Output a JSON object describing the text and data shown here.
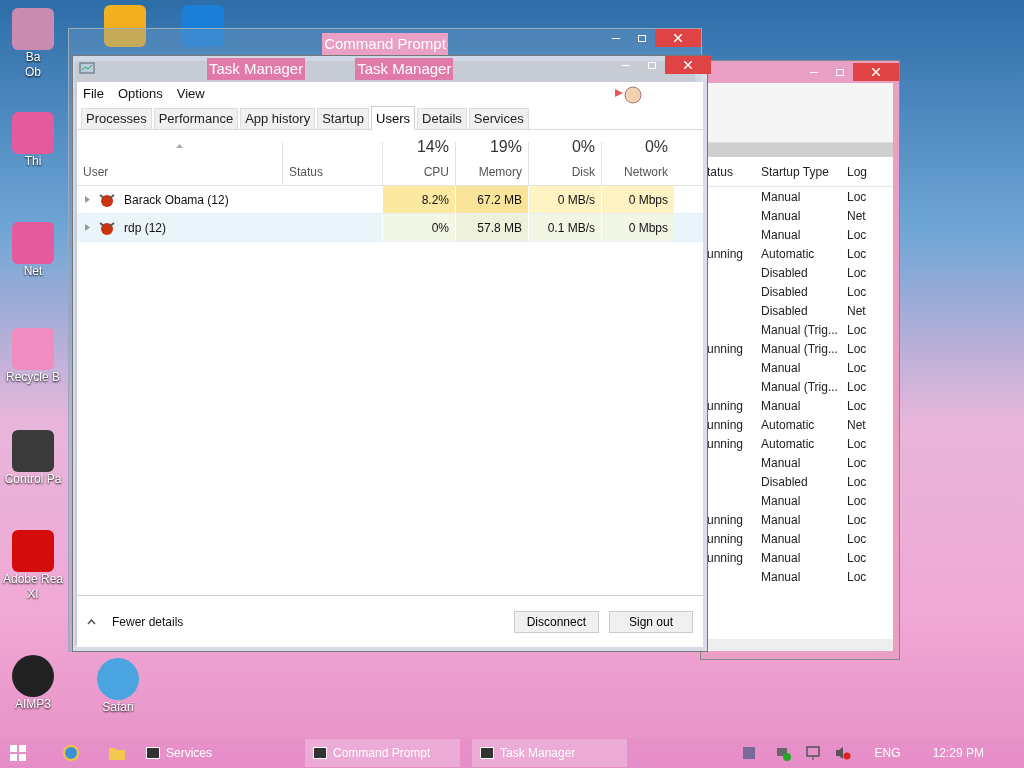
{
  "desktop_icons": [
    {
      "kind": "person",
      "lines": [
        "Ba",
        "Ob"
      ]
    },
    {
      "kind": "pink",
      "lines": [
        "Thi"
      ]
    },
    {
      "kind": "pink",
      "lines": [
        "Net"
      ]
    },
    {
      "kind": "recycle",
      "lines": [
        "Recycle B"
      ]
    },
    {
      "kind": "control",
      "lines": [
        "Control Pa"
      ]
    },
    {
      "kind": "pdf",
      "lines": [
        "Adobe Rea",
        "XI"
      ]
    },
    {
      "kind": "aimp",
      "lines": [
        "AIMP3"
      ]
    },
    {
      "kind": "safari",
      "lines": [
        "Safari"
      ]
    },
    {
      "kind": "video"
    },
    {
      "kind": "remote"
    }
  ],
  "command_prompt": {
    "title": "Command Prompt"
  },
  "services_window": {
    "columns": [
      "tatus",
      "Startup Type",
      "Log"
    ],
    "rows": [
      [
        "",
        "Manual",
        "Loc"
      ],
      [
        "",
        "Manual",
        "Net"
      ],
      [
        "",
        "Manual",
        "Loc"
      ],
      [
        "unning",
        "Automatic",
        "Loc"
      ],
      [
        "",
        "Disabled",
        "Loc"
      ],
      [
        "",
        "Disabled",
        "Loc"
      ],
      [
        "",
        "Disabled",
        "Net"
      ],
      [
        "",
        "Manual (Trig...",
        "Loc"
      ],
      [
        "unning",
        "Manual (Trig...",
        "Loc"
      ],
      [
        "",
        "Manual",
        "Loc"
      ],
      [
        "",
        "Manual (Trig...",
        "Loc"
      ],
      [
        "unning",
        "Manual",
        "Loc"
      ],
      [
        "unning",
        "Automatic",
        "Net"
      ],
      [
        "unning",
        "Automatic",
        "Loc"
      ],
      [
        "",
        "Manual",
        "Loc"
      ],
      [
        "",
        "Disabled",
        "Loc"
      ],
      [
        "",
        "Manual",
        "Loc"
      ],
      [
        "unning",
        "Manual",
        "Loc"
      ],
      [
        "unning",
        "Manual",
        "Loc"
      ],
      [
        "unning",
        "Manual",
        "Loc"
      ],
      [
        "",
        "Manual",
        "Loc"
      ]
    ]
  },
  "task_manager": {
    "titles": [
      "Task Manager",
      "Task Manager"
    ],
    "menu": [
      "File",
      "Options",
      "View"
    ],
    "tabs": [
      {
        "label": "Processes",
        "selected": false
      },
      {
        "label": "Performance",
        "selected": false
      },
      {
        "label": "App history",
        "selected": false
      },
      {
        "label": "Startup",
        "selected": false
      },
      {
        "label": "Users",
        "selected": true
      },
      {
        "label": "Details",
        "selected": false
      },
      {
        "label": "Services",
        "selected": false
      }
    ],
    "columns": [
      {
        "label": "User"
      },
      {
        "label": "Status"
      },
      {
        "total": "14%",
        "label": "CPU"
      },
      {
        "total": "19%",
        "label": "Memory"
      },
      {
        "total": "0%",
        "label": "Disk"
      },
      {
        "total": "0%",
        "label": "Network"
      }
    ],
    "rows": [
      {
        "highlighted": false,
        "cells": [
          {
            "text": "Barack Obama (12)"
          },
          {
            "text": ""
          },
          {
            "text": "8.2%",
            "color": "#fbe9a2"
          },
          {
            "text": "67.2 MB",
            "color": "#f9e49a"
          },
          {
            "text": "0 MB/s",
            "color": "#fff3c4"
          },
          {
            "text": "0 Mbps",
            "color": "#fff3c4"
          }
        ]
      },
      {
        "highlighted": true,
        "cells": [
          {
            "text": "rdp (12)"
          },
          {
            "text": ""
          },
          {
            "text": "0%",
            "color": "#f2f6e4"
          },
          {
            "text": "57.8 MB",
            "color": "#eef2dc"
          },
          {
            "text": "0.1 MB/s",
            "color": "#f2f6e4"
          },
          {
            "text": "0 Mbps",
            "color": "#f2f6e4"
          }
        ]
      }
    ],
    "fewer_details": "Fewer details",
    "buttons": [
      "Disconnect",
      "Sign out"
    ]
  },
  "taskbar": {
    "items": [
      {
        "label": "Services",
        "active": false
      },
      {
        "label": "Command Prompt",
        "active": true
      },
      {
        "label": "Task Manager",
        "active": true
      }
    ],
    "language": "ENG",
    "time": "12:29 PM"
  }
}
